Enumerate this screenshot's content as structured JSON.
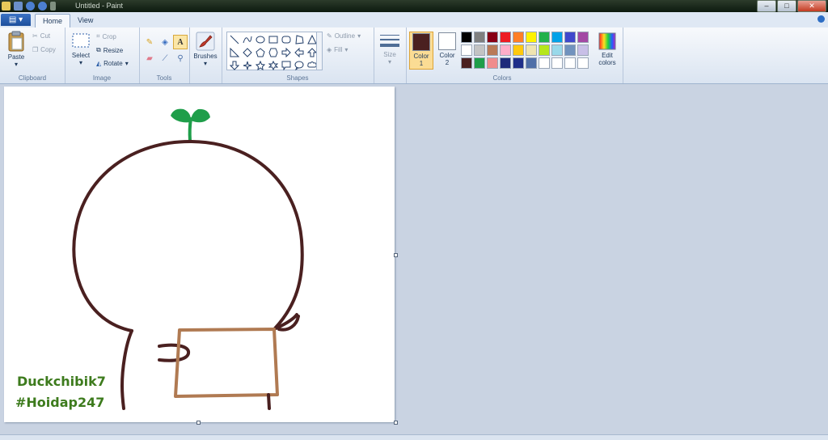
{
  "window": {
    "title": "Untitled - Paint"
  },
  "tabs": [
    {
      "label": "Home"
    },
    {
      "label": "View"
    }
  ],
  "clipboard": {
    "group": "Clipboard",
    "paste": "Paste",
    "cut": "Cut",
    "copy": "Copy"
  },
  "image": {
    "group": "Image",
    "select": "Select",
    "crop": "Crop",
    "resize": "Resize",
    "rotate": "Rotate"
  },
  "tools": {
    "group": "Tools",
    "brushes": "Brushes"
  },
  "shapes": {
    "group": "Shapes",
    "outline": "Outline",
    "fill": "Fill"
  },
  "size": {
    "label": "Size"
  },
  "colors": {
    "group": "Colors",
    "color1": {
      "label1": "Color",
      "label2": "1",
      "value": "#4a2020"
    },
    "color2": {
      "label1": "Color",
      "label2": "2",
      "value": "#ffffff"
    },
    "edit": {
      "label1": "Edit",
      "label2": "colors"
    },
    "palette": [
      "#000000",
      "#7f7f7f",
      "#880015",
      "#ed1c24",
      "#ff7f27",
      "#fff200",
      "#22b14c",
      "#00a2e8",
      "#3f48cc",
      "#a349a4",
      "#ffffff",
      "#c3c3c3",
      "#b97a57",
      "#ffaec9",
      "#ffc90e",
      "#efe4b0",
      "#b5e61d",
      "#99d9ea",
      "#7092be",
      "#c8bfe7",
      "#4a2020",
      "#1f9e4a",
      "#f08c8c",
      "#1d2a7a",
      "#1f2f8a",
      "#4f6fa8",
      "#ffffff",
      "#ffffff",
      "#ffffff",
      "#ffffff"
    ]
  },
  "drawing": {
    "line1": "Duckchibik7",
    "line2": "#Hoidap247",
    "colors": {
      "outline": "#4a2020",
      "sprout": "#1f9e4a",
      "sign": "#b07a52",
      "text": "#3d7b1d"
    }
  }
}
